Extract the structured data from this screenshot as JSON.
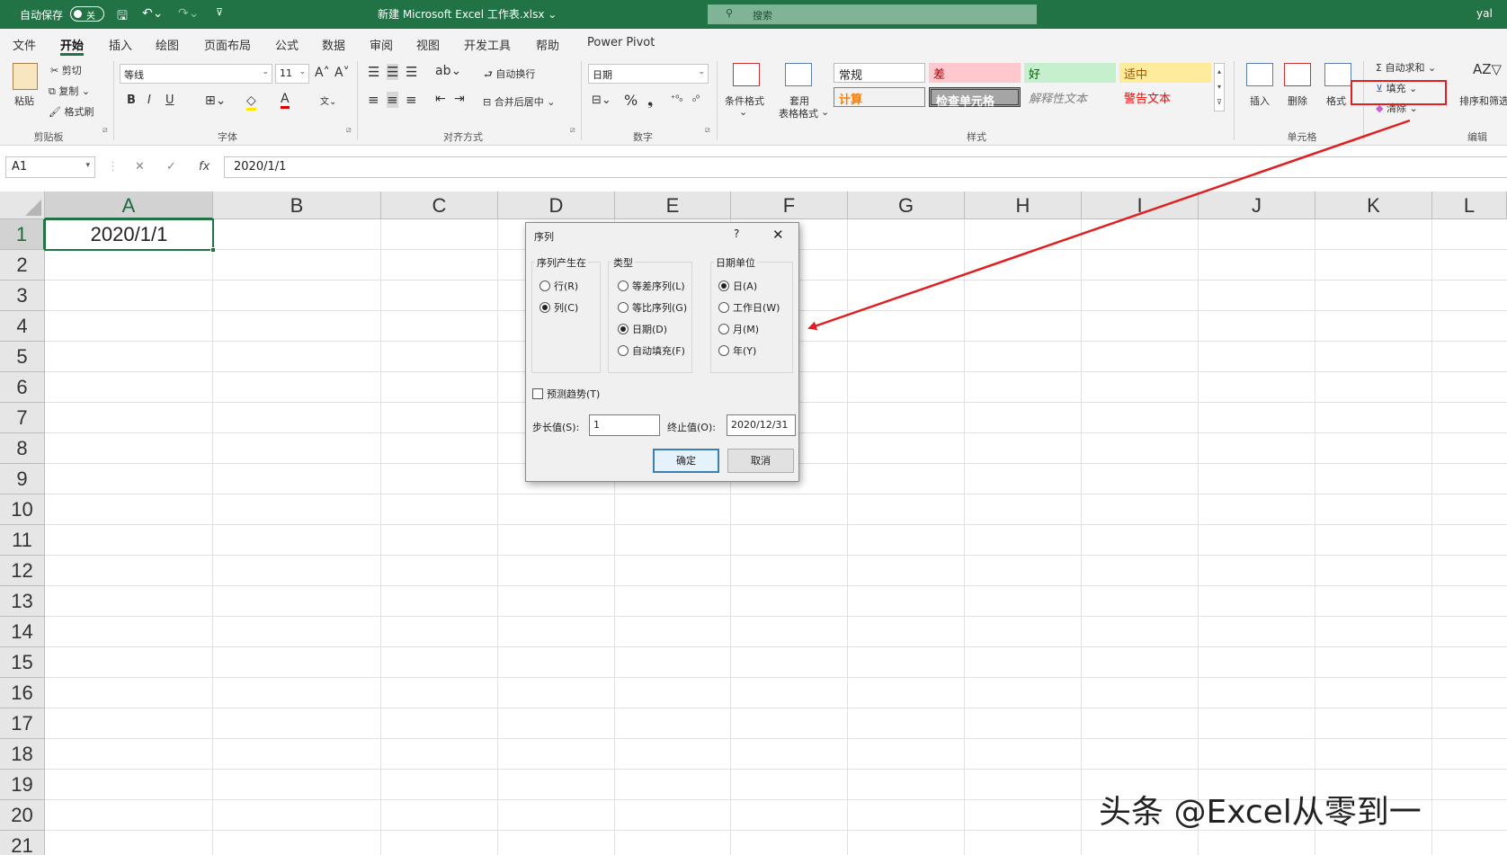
{
  "titlebar": {
    "autosave_label": "自动保存",
    "autosave_state": "关",
    "doc_title": "新建 Microsoft Excel 工作表.xlsx ⌄",
    "search_placeholder": "搜索",
    "user": "yal"
  },
  "tabs": [
    "文件",
    "开始",
    "插入",
    "绘图",
    "页面布局",
    "公式",
    "数据",
    "审阅",
    "视图",
    "开发工具",
    "帮助",
    "Power Pivot"
  ],
  "active_tab": "开始",
  "ribbon": {
    "clipboard": {
      "paste": "粘贴",
      "cut": "剪切",
      "copy": "复制",
      "format_painter": "格式刷",
      "group": "剪贴板"
    },
    "font": {
      "family": "等线",
      "size": "11",
      "bold": "B",
      "italic": "I",
      "underline": "U",
      "group": "字体"
    },
    "alignment": {
      "wrap": "自动换行",
      "merge": "合并后居中",
      "group": "对齐方式"
    },
    "number": {
      "format": "日期",
      "percent": "%",
      "group": "数字"
    },
    "styles": {
      "conditional": "条件格式",
      "table_format_1": "套用",
      "table_format_2": "表格格式",
      "cells": [
        {
          "label": "常规"
        },
        {
          "label": "差"
        },
        {
          "label": "好"
        },
        {
          "label": "适中"
        },
        {
          "label": "计算"
        },
        {
          "label": "检查单元格"
        },
        {
          "label": "解释性文本"
        },
        {
          "label": "警告文本"
        }
      ],
      "group": "样式"
    },
    "cells": {
      "insert": "插入",
      "delete": "删除",
      "format": "格式",
      "group": "单元格"
    },
    "editing": {
      "autosum": "自动求和",
      "fill": "填充",
      "clear": "清除",
      "sort": "排序和筛选",
      "group": "编辑"
    }
  },
  "formula_bar": {
    "name_box": "A1",
    "formula": "2020/1/1",
    "cancel": "✕",
    "enter": "✓",
    "fx": "fx"
  },
  "columns": [
    "A",
    "B",
    "C",
    "D",
    "E",
    "F",
    "G",
    "H",
    "I",
    "J",
    "K",
    "L"
  ],
  "rows": [
    "1",
    "2",
    "3",
    "4",
    "5",
    "6",
    "7",
    "8",
    "9",
    "10",
    "11",
    "12",
    "13",
    "14",
    "15",
    "16",
    "17",
    "18",
    "19",
    "20",
    "21"
  ],
  "cell_a1": "2020/1/1",
  "dialog": {
    "title": "序列",
    "help": "?",
    "close": "✕",
    "series_in": {
      "label": "序列产生在",
      "row": "行(R)",
      "col": "列(C)",
      "selected": "列(C)"
    },
    "type": {
      "label": "类型",
      "linear": "等差序列(L)",
      "growth": "等比序列(G)",
      "date": "日期(D)",
      "autofill": "自动填充(F)",
      "selected": "日期(D)"
    },
    "date_unit": {
      "label": "日期单位",
      "day": "日(A)",
      "weekday": "工作日(W)",
      "month": "月(M)",
      "year": "年(Y)",
      "selected": "日(A)"
    },
    "trend": "预测趋势(T)",
    "step_label": "步长值(S):",
    "step_value": "1",
    "stop_label": "终止值(O):",
    "stop_value": "2020/12/31",
    "ok": "确定",
    "cancel": "取消"
  },
  "colors": {
    "excel_green": "#217346",
    "annotation_red": "#e02020"
  },
  "watermark": "头条 @Excel从零到一"
}
